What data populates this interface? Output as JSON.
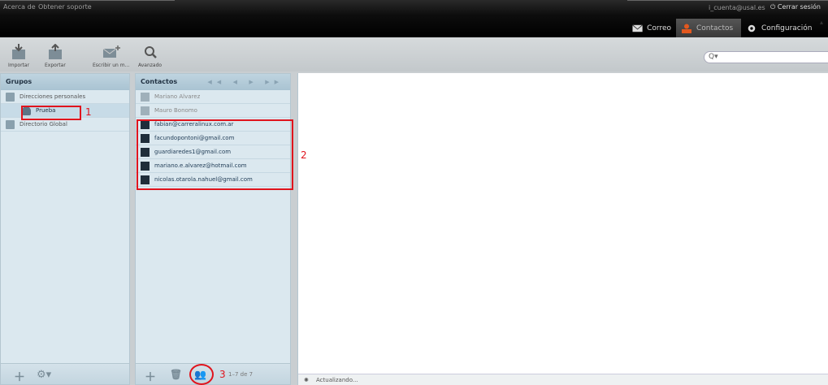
{
  "topbar": {
    "about": "Acerca de",
    "support": "Obtener soporte",
    "user": "i_cuenta@usal.es",
    "logout": "Cerrar sesión",
    "tasks": [
      {
        "label": "Correo",
        "icon": "envelope-icon"
      },
      {
        "label": "Contactos",
        "icon": "person-icon"
      },
      {
        "label": "Configuración",
        "icon": "gear-icon"
      }
    ]
  },
  "toolbar": {
    "import": "Importar",
    "export": "Exportar",
    "compose": "Escribir un m...",
    "advanced": "Avanzado",
    "search_icon": "Q▾"
  },
  "groups": {
    "title": "Grupos",
    "items": [
      {
        "label": "Direcciones personales"
      },
      {
        "label": "Prueba"
      },
      {
        "label": "Directorio Global"
      }
    ]
  },
  "contacts": {
    "title": "Contactos",
    "pager": "◀◀ ◀ ▶ ▶▶",
    "items": [
      {
        "label": "Mariano Alvarez"
      },
      {
        "label": "Mauro Bonomo"
      },
      {
        "label": "fabian@carreralinux.com.ar"
      },
      {
        "label": "facundopontoni@gmail.com"
      },
      {
        "label": "guardiaredes1@gmail.com"
      },
      {
        "label": "mariano.e.alvarez@hotmail.com"
      },
      {
        "label": "nicolas.otarola.nahuel@gmail.com"
      }
    ],
    "count": "1–7 de 7"
  },
  "detail": {
    "status": "Actualizando..."
  },
  "annotations": {
    "one": "1",
    "two": "2",
    "three": "3"
  },
  "colors": {
    "annotation": "#e0141d",
    "panel": "#dbe8ef",
    "header": "#a9c3d2"
  }
}
